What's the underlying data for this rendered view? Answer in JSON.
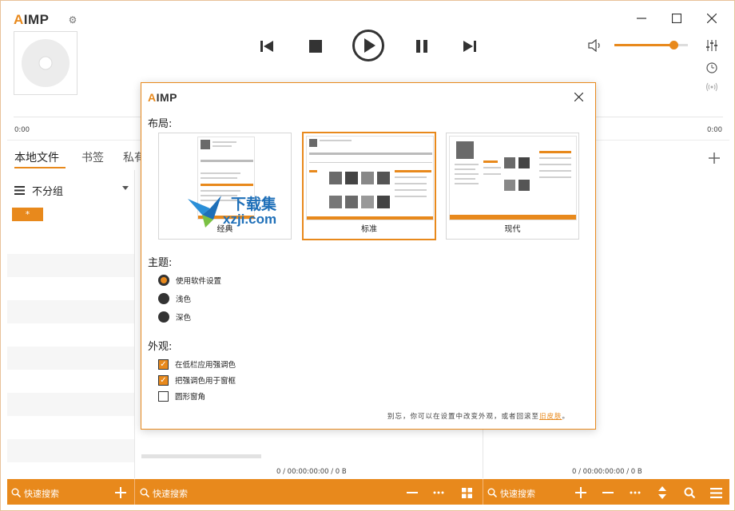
{
  "app": {
    "logo_text": "IMP",
    "logo_prefix": "A",
    "accent": "#e8891c"
  },
  "titlebar": {
    "minimize_icon": "minimize-icon",
    "maximize_icon": "maximize-icon",
    "close_icon": "close-icon"
  },
  "player": {
    "time_left": "0:00",
    "time_right": "0:00",
    "volume_level": 0.8
  },
  "tabs": {
    "local_files": "本地文件",
    "bookmarks": "书签",
    "private": "私有"
  },
  "group": {
    "label": "不分组"
  },
  "playlist": {
    "star_button": "*"
  },
  "status": {
    "middle": "0 / 00:00:00:00 / 0 B",
    "right": "0 / 00:00:00:00 / 0 B"
  },
  "bottom": {
    "search_left": "快速搜索",
    "search_middle": "快速搜索",
    "search_right": "快速搜索"
  },
  "dialog": {
    "logo_text": "IMP",
    "logo_prefix": "A",
    "layout_title": "布局:",
    "layouts": [
      {
        "label": "经典"
      },
      {
        "label": "标准"
      },
      {
        "label": "现代"
      }
    ],
    "theme_title": "主题:",
    "themes": [
      {
        "label": "使用软件设置"
      },
      {
        "label": "浅色"
      },
      {
        "label": "深色"
      }
    ],
    "appearance_title": "外观:",
    "appearance": [
      {
        "label": "在低栏应用强调色"
      },
      {
        "label": "把强调色用于窗框"
      },
      {
        "label": "圆形窗角"
      }
    ],
    "footnote_prefix": "别忘，你可以在设置中改变外观，或者回滚至",
    "footnote_link": "旧皮肤",
    "footnote_suffix": "。"
  },
  "watermark": {
    "line1": "下载集",
    "line2": "xzji.com"
  }
}
